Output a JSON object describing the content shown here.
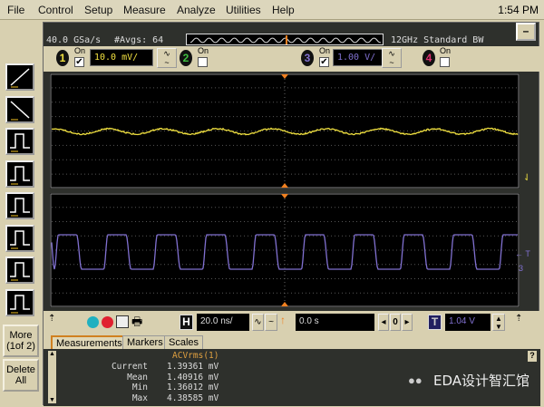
{
  "menu": [
    "File",
    "Control",
    "Setup",
    "Measure",
    "Analyze",
    "Utilities",
    "Help"
  ],
  "clock": "1:54 PM",
  "info": {
    "sample_rate": "40.0 GSa/s",
    "avgs": "#Avgs: 64",
    "bandwidth": "12GHz Standard BW",
    "minimize": "–"
  },
  "channels": [
    {
      "num": "1",
      "on_label": "On",
      "checked": true,
      "scale": "10.0 mV/",
      "color": "#f0e040"
    },
    {
      "num": "2",
      "on_label": "On",
      "checked": false,
      "color": "#40c040"
    },
    {
      "num": "3",
      "on_label": "On",
      "checked": true,
      "scale": "1.00 V/",
      "color": "#8070d0"
    },
    {
      "num": "4",
      "on_label": "On",
      "checked": false,
      "color": "#e03070"
    }
  ],
  "left_toolbar": {
    "more": "More",
    "more_sub": "(1of 2)",
    "delete": "Delete",
    "delete_sub": "All"
  },
  "controls": {
    "h_label": "H",
    "timebase": "20.0 ns/",
    "delay": "0.0 s",
    "delay_ref": "0",
    "t_label": "T",
    "trigger_level": "1.04 V"
  },
  "tabs": [
    "Measurements",
    "Markers",
    "Scales"
  ],
  "measurement": {
    "title": "ACVrms(1)",
    "rows": [
      {
        "label": "Current",
        "value": "1.39361 mV"
      },
      {
        "label": "Mean",
        "value": "1.40916 mV"
      },
      {
        "label": "Min",
        "value": "1.36012 mV"
      },
      {
        "label": "Max",
        "value": "4.38585 mV"
      }
    ],
    "help": "?"
  },
  "watermark": "EDA设计智汇馆",
  "markers": {
    "trigger": "← T",
    "ch3": "3"
  }
}
